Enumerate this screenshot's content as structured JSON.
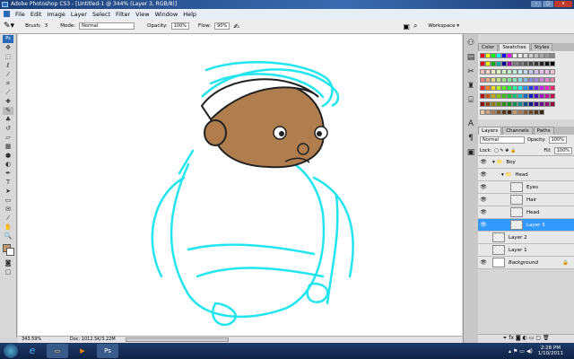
{
  "window": {
    "title": "Adobe Photoshop CS3 - [Untitled-1 @ 344% (Layer 3, RGB/8)]"
  },
  "menu": [
    "File",
    "Edit",
    "Image",
    "Layer",
    "Select",
    "Filter",
    "View",
    "Window",
    "Help"
  ],
  "options": {
    "brush_label": "Brush:",
    "brush_size": "3",
    "mode_label": "Mode:",
    "mode_value": "Normal",
    "opacity_label": "Opacity:",
    "opacity_value": "100%",
    "flow_label": "Flow:",
    "flow_value": "90%",
    "workspace_label": "Workspace ▾"
  },
  "status": {
    "zoom": "343.59%",
    "doc": "Doc: 1012.5K/3.22M"
  },
  "swatch_panel": {
    "tabs": [
      "Color",
      "Swatches",
      "Styles"
    ],
    "active": "Swatches"
  },
  "layers_panel": {
    "tabs": [
      "Layers",
      "Channels",
      "Paths"
    ],
    "blend_mode": "Normal",
    "opacity_label": "Opacity:",
    "opacity": "100%",
    "lock_label": "Lock:",
    "fill_label": "Fill:",
    "fill": "100%",
    "layers": [
      {
        "name": "Boy",
        "type": "group",
        "indent": 0,
        "visible": true
      },
      {
        "name": "Head",
        "type": "group",
        "indent": 1,
        "visible": true
      },
      {
        "name": "Eyes",
        "type": "layer",
        "indent": 2,
        "visible": true
      },
      {
        "name": "Hair",
        "type": "layer",
        "indent": 2,
        "visible": true
      },
      {
        "name": "Head",
        "type": "layer",
        "indent": 2,
        "visible": true
      },
      {
        "name": "Layer 3",
        "type": "layer",
        "indent": 2,
        "visible": true,
        "selected": true
      },
      {
        "name": "Layer 2",
        "type": "layer",
        "indent": 0,
        "visible": false
      },
      {
        "name": "Layer 1",
        "type": "layer",
        "indent": 0,
        "visible": false
      },
      {
        "name": "Background",
        "type": "background",
        "indent": 0,
        "visible": true,
        "locked": true
      }
    ]
  },
  "colors": {
    "foreground": "#c49a6c",
    "sketch": "#22e5f0",
    "skin": "#b07d4f",
    "selection": "#3399ff"
  },
  "taskbar": {
    "time": "2:28 PM",
    "date": "1/10/2011",
    "ps_label": "Ps"
  }
}
